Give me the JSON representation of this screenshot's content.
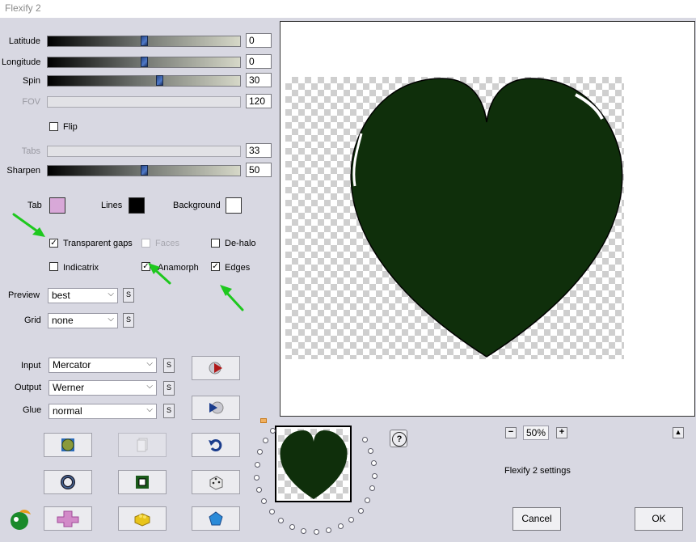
{
  "app_title": "Flexify 2",
  "sliders": [
    {
      "label": "Latitude",
      "value": "0",
      "disabled": false,
      "level": 0.5
    },
    {
      "label": "Longitude",
      "value": "0",
      "disabled": false,
      "level": 0.5
    },
    {
      "label": "Spin",
      "value": "30",
      "disabled": false,
      "level": 0.58
    },
    {
      "label": "FOV",
      "value": "120",
      "disabled": true,
      "level": null
    },
    {
      "label": "Tabs",
      "value": "33",
      "disabled": true,
      "level": null
    },
    {
      "label": "Sharpen",
      "value": "50",
      "disabled": false,
      "level": 0.5
    }
  ],
  "flip": {
    "label": "Flip",
    "checked": false
  },
  "colors": {
    "tab": {
      "label": "Tab",
      "color": "#d8a8d8"
    },
    "lines": {
      "label": "Lines",
      "color": "#000000"
    },
    "background": {
      "label": "Background",
      "color": "#ffffff"
    }
  },
  "options": {
    "transparent_gaps": {
      "label": "Transparent gaps",
      "checked": true
    },
    "faces": {
      "label": "Faces",
      "checked": false,
      "disabled": true
    },
    "de_halo": {
      "label": "De-halo",
      "checked": false
    },
    "indicatrix": {
      "label": "Indicatrix",
      "checked": false
    },
    "anamorph": {
      "label": "Anamorph",
      "checked": true
    },
    "edges": {
      "label": "Edges",
      "checked": true
    }
  },
  "preview_select": {
    "label": "Preview",
    "value": "best"
  },
  "grid_select": {
    "label": "Grid",
    "value": "none"
  },
  "input_select": {
    "label": "Input",
    "value": "Mercator"
  },
  "output_select": {
    "label": "Output",
    "value": "Werner"
  },
  "glue_select": {
    "label": "Glue",
    "value": "normal"
  },
  "s_label": "S",
  "zoom": {
    "value": "50%",
    "minus": "−",
    "plus": "+"
  },
  "settings_label": "Flexify 2 settings",
  "help_label": "?",
  "collapse_label": "▲",
  "cancel_label": "Cancel",
  "ok_label": "OK",
  "heart_color": "#0f2f0b",
  "annotation_color": "#1ec81e"
}
